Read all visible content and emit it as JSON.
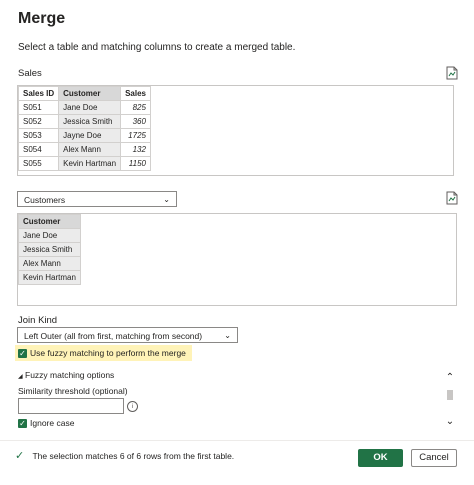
{
  "dialog": {
    "title": "Merge",
    "subtitle": "Select a table and matching columns to create a merged table."
  },
  "first_table": {
    "name": "Sales",
    "columns": [
      "Sales ID",
      "Customer",
      "Sales"
    ],
    "rows": [
      [
        "S051",
        "Jane Doe",
        "825"
      ],
      [
        "S052",
        "Jessica Smith",
        "360"
      ],
      [
        "S053",
        "Jayne Doe",
        "1725"
      ],
      [
        "S054",
        "Alex Mann",
        "132"
      ],
      [
        "S055",
        "Kevin Hartman",
        "1150"
      ]
    ]
  },
  "second_table": {
    "selected": "Customers",
    "columns": [
      "Customer"
    ],
    "rows": [
      [
        "Jane Doe"
      ],
      [
        "Jessica Smith"
      ],
      [
        "Alex Mann"
      ],
      [
        "Kevin Hartman"
      ]
    ]
  },
  "join": {
    "label": "Join Kind",
    "selected": "Left Outer (all from first, matching from second)"
  },
  "fuzzy": {
    "enable_label": "Use fuzzy matching to perform the merge",
    "options_label": "Fuzzy matching options",
    "threshold_label": "Similarity threshold (optional)",
    "threshold_value": "",
    "ignore_case_label": "Ignore case",
    "info_glyph": "i"
  },
  "status": {
    "message": "The selection matches 6 of 6 rows from the first table."
  },
  "buttons": {
    "ok": "OK",
    "cancel": "Cancel"
  },
  "colors": {
    "accent": "#217346",
    "highlight": "#fff3b8"
  },
  "icons": {
    "preview": "document-preview-icon",
    "check": "checkmark-icon"
  }
}
